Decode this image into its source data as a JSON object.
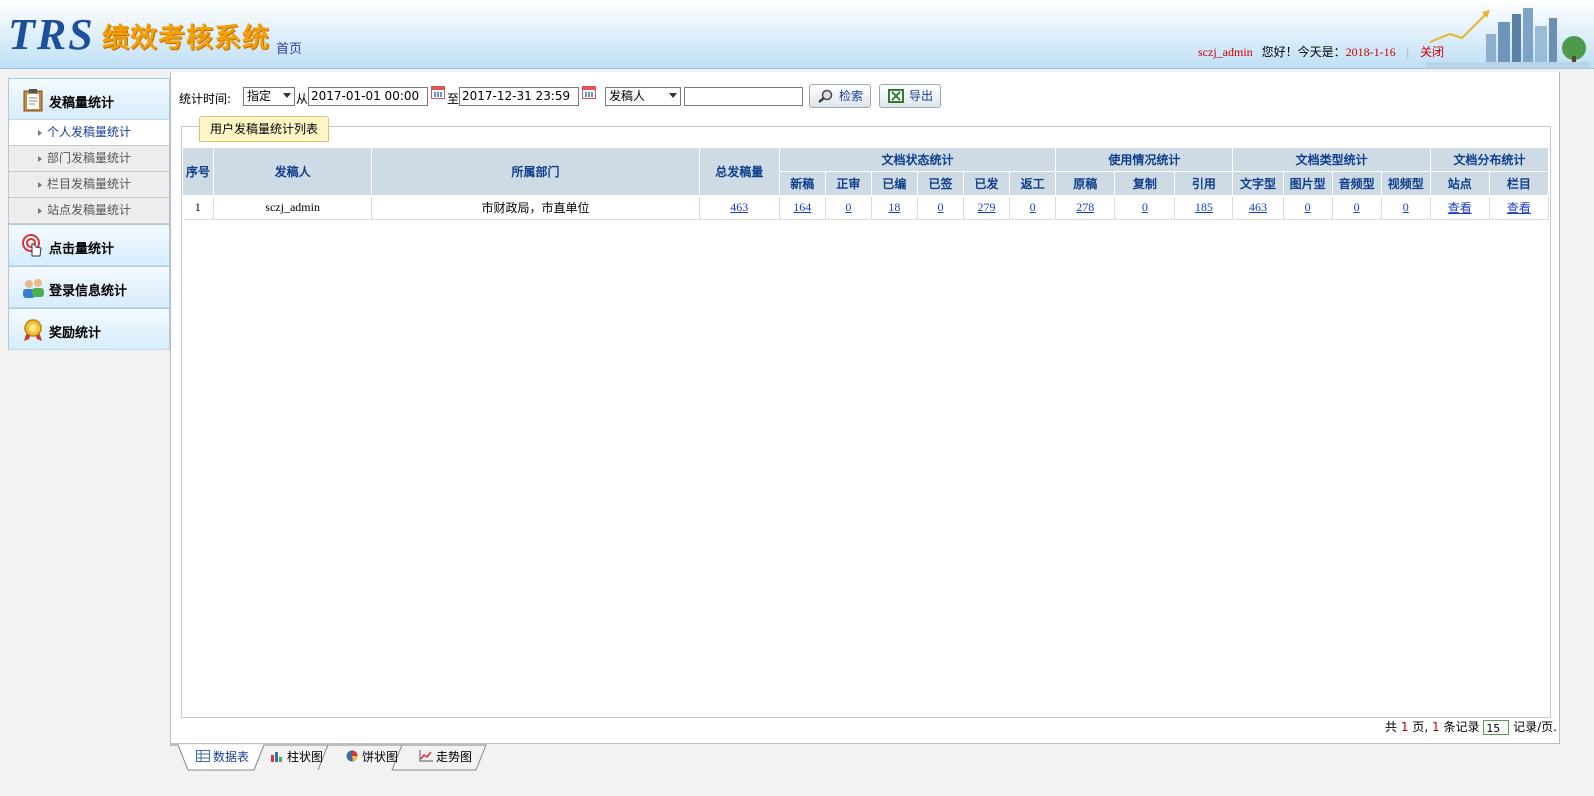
{
  "header": {
    "logo": "TRS",
    "system_name": "绩效考核系统",
    "home_link": "首页",
    "username": "sczj_admin",
    "greeting": "您好！今天是：",
    "date": "2018-1-16",
    "separator": "|",
    "close": "关闭"
  },
  "sidebar": {
    "sections": [
      {
        "label": "发稿量统计",
        "icon": "clipboard-icon"
      },
      {
        "label": "点击量统计",
        "icon": "hand-click-icon"
      },
      {
        "label": "登录信息统计",
        "icon": "users-icon"
      },
      {
        "label": "奖励统计",
        "icon": "medal-icon"
      }
    ],
    "sub_items": [
      {
        "label": "个人发稿量统计",
        "active": true
      },
      {
        "label": "部门发稿量统计",
        "active": false
      },
      {
        "label": "栏目发稿量统计",
        "active": false
      },
      {
        "label": "站点发稿量统计",
        "active": false
      }
    ]
  },
  "toolbar": {
    "time_label": "统计时间:",
    "mode_select": "指定",
    "from_label": "从",
    "start_time": "2017-01-01 00:00",
    "to_label": "至",
    "end_time": "2017-12-31 23:59",
    "field_select": "发稿人",
    "search_value": "",
    "search_button": "检索",
    "export_button": "导出"
  },
  "panel": {
    "legend": "用户发稿量统计列表"
  },
  "table": {
    "group_headers": {
      "seq": "序号",
      "author": "发稿人",
      "dept": "所属部门",
      "total": "总发稿量",
      "status": "文档状态统计",
      "usage": "使用情况统计",
      "type": "文档类型统计",
      "dist": "文档分布统计"
    },
    "sub_headers": [
      "新稿",
      "正审",
      "已编",
      "已签",
      "已发",
      "返工",
      "原稿",
      "复制",
      "引用",
      "文字型",
      "图片型",
      "音频型",
      "视频型",
      "站点",
      "栏目"
    ],
    "rows": [
      {
        "seq": "1",
        "author": "sczj_admin",
        "dept": "市财政局，市直单位",
        "total": "463",
        "values": [
          "164",
          "0",
          "18",
          "0",
          "279",
          "0",
          "278",
          "0",
          "185",
          "463",
          "0",
          "0",
          "0",
          "查看",
          "查看"
        ]
      }
    ]
  },
  "pager": {
    "prefix": "共",
    "pages": "1",
    "pages_suffix": "页,",
    "records": "1",
    "records_suffix": "条记录",
    "per_page": "15",
    "per_page_suffix": "记录/页."
  },
  "tabs": [
    {
      "label": "数据表",
      "icon": "table-icon",
      "active": true
    },
    {
      "label": "柱状图",
      "icon": "bar-chart-icon",
      "active": false
    },
    {
      "label": "饼状图",
      "icon": "pie-chart-icon",
      "active": false
    },
    {
      "label": "走势图",
      "icon": "line-chart-icon",
      "active": false
    }
  ]
}
